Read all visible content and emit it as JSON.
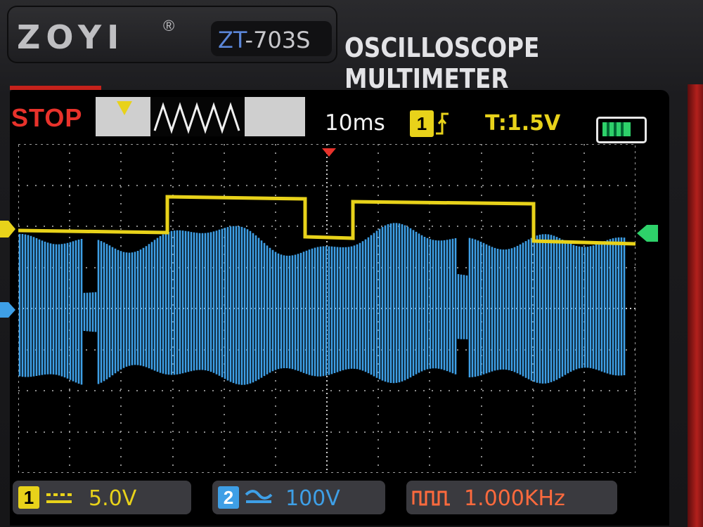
{
  "brand": {
    "name": "ZOYI",
    "registered": "®",
    "model_prefix": "ZT",
    "model_suffix": "-703S",
    "tagline": "OSCILLOSCOPE MULTIMETER"
  },
  "status": {
    "run_state": "STOP",
    "timebase": "10ms",
    "trigger_channel": "1",
    "trigger_level": "T:1.5V",
    "battery": "full"
  },
  "channels": {
    "ch1": {
      "badge": "1",
      "coupling": "DC",
      "scale": "5.0V",
      "color": "#e8d21a"
    },
    "ch2": {
      "badge": "2",
      "coupling": "AC",
      "scale": "100V",
      "color": "#3e9fe6"
    }
  },
  "measurement": {
    "frequency": "1.000KHz",
    "color": "#ff6a3d"
  },
  "icons": [
    "trigger-position-icon",
    "rising-edge-icon",
    "battery-icon",
    "dc-coupling-icon",
    "ac-coupling-icon",
    "pulse-icon"
  ]
}
